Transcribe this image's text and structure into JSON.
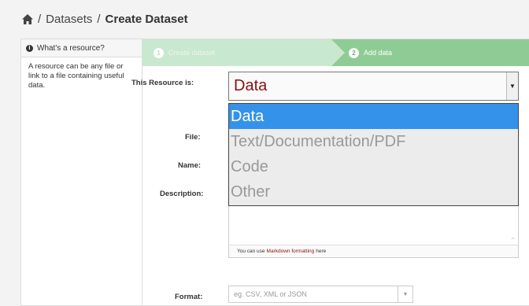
{
  "breadcrumb": {
    "home_icon": "home-icon",
    "separator": "/",
    "datasets": "Datasets",
    "current": "Create Dataset"
  },
  "sidebar": {
    "heading": "What's a resource?",
    "body": "A resource can be any file or link to a file containing useful data."
  },
  "stages": [
    {
      "number": "1",
      "label": "Create dataset"
    },
    {
      "number": "2",
      "label": "Add data"
    }
  ],
  "form": {
    "resource_type_label": "This Resource is:",
    "resource_type_value": "Data",
    "resource_type_options": [
      "Data",
      "Text/Documentation/PDF",
      "Code",
      "Other"
    ],
    "file_label": "File:",
    "name_label": "Name:",
    "description_label": "Description:",
    "markdown_prefix": "You can use",
    "markdown_link": "Markdown formatting",
    "markdown_suffix": "here",
    "format_label": "Format:",
    "format_placeholder": "eg. CSV, XML or JSON"
  },
  "colors": {
    "stage_done": "#c9e8d0",
    "stage_active": "#8fcc95",
    "select_value": "#8a1010",
    "option_highlight": "#3592ea"
  }
}
